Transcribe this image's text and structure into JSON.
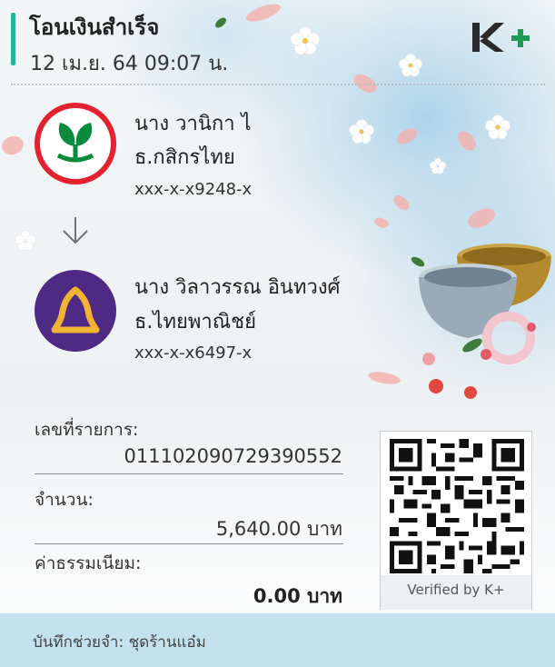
{
  "header": {
    "title": "โอนเงินสำเร็จ",
    "datetime": "12 เม.ย. 64  09:07 น.",
    "brand": "K+"
  },
  "sender": {
    "name": "นาง วานิกา ไ",
    "bank": "ธ.กสิกรไทย",
    "account": "xxx-x-x9248-x"
  },
  "receiver": {
    "name": "นาง วิลาวรรณ อินทวงศ์",
    "bank": "ธ.ไทยพาณิชย์",
    "account": "xxx-x-x6497-x"
  },
  "details": {
    "ref_label": "เลขที่รายการ:",
    "ref_value": "011102090729390552",
    "amount_label": "จำนวน:",
    "amount_value": "5,640.00 บาท",
    "fee_label": "ค่าธรรมเนียม:",
    "fee_value": "0.00 บาท"
  },
  "qr": {
    "verified_label": "Verified by K+"
  },
  "memo": {
    "text": "บันทึกช่วยจำ:  ชุดร้านแอ๋ม"
  },
  "colors": {
    "accent": "#27b39a",
    "kplus_green": "#1f9a52",
    "kbank_red": "#e4222f",
    "scb_purple": "#4e2a84",
    "scb_gold": "#f2b233",
    "memo_bg": "#c3e2ee"
  }
}
